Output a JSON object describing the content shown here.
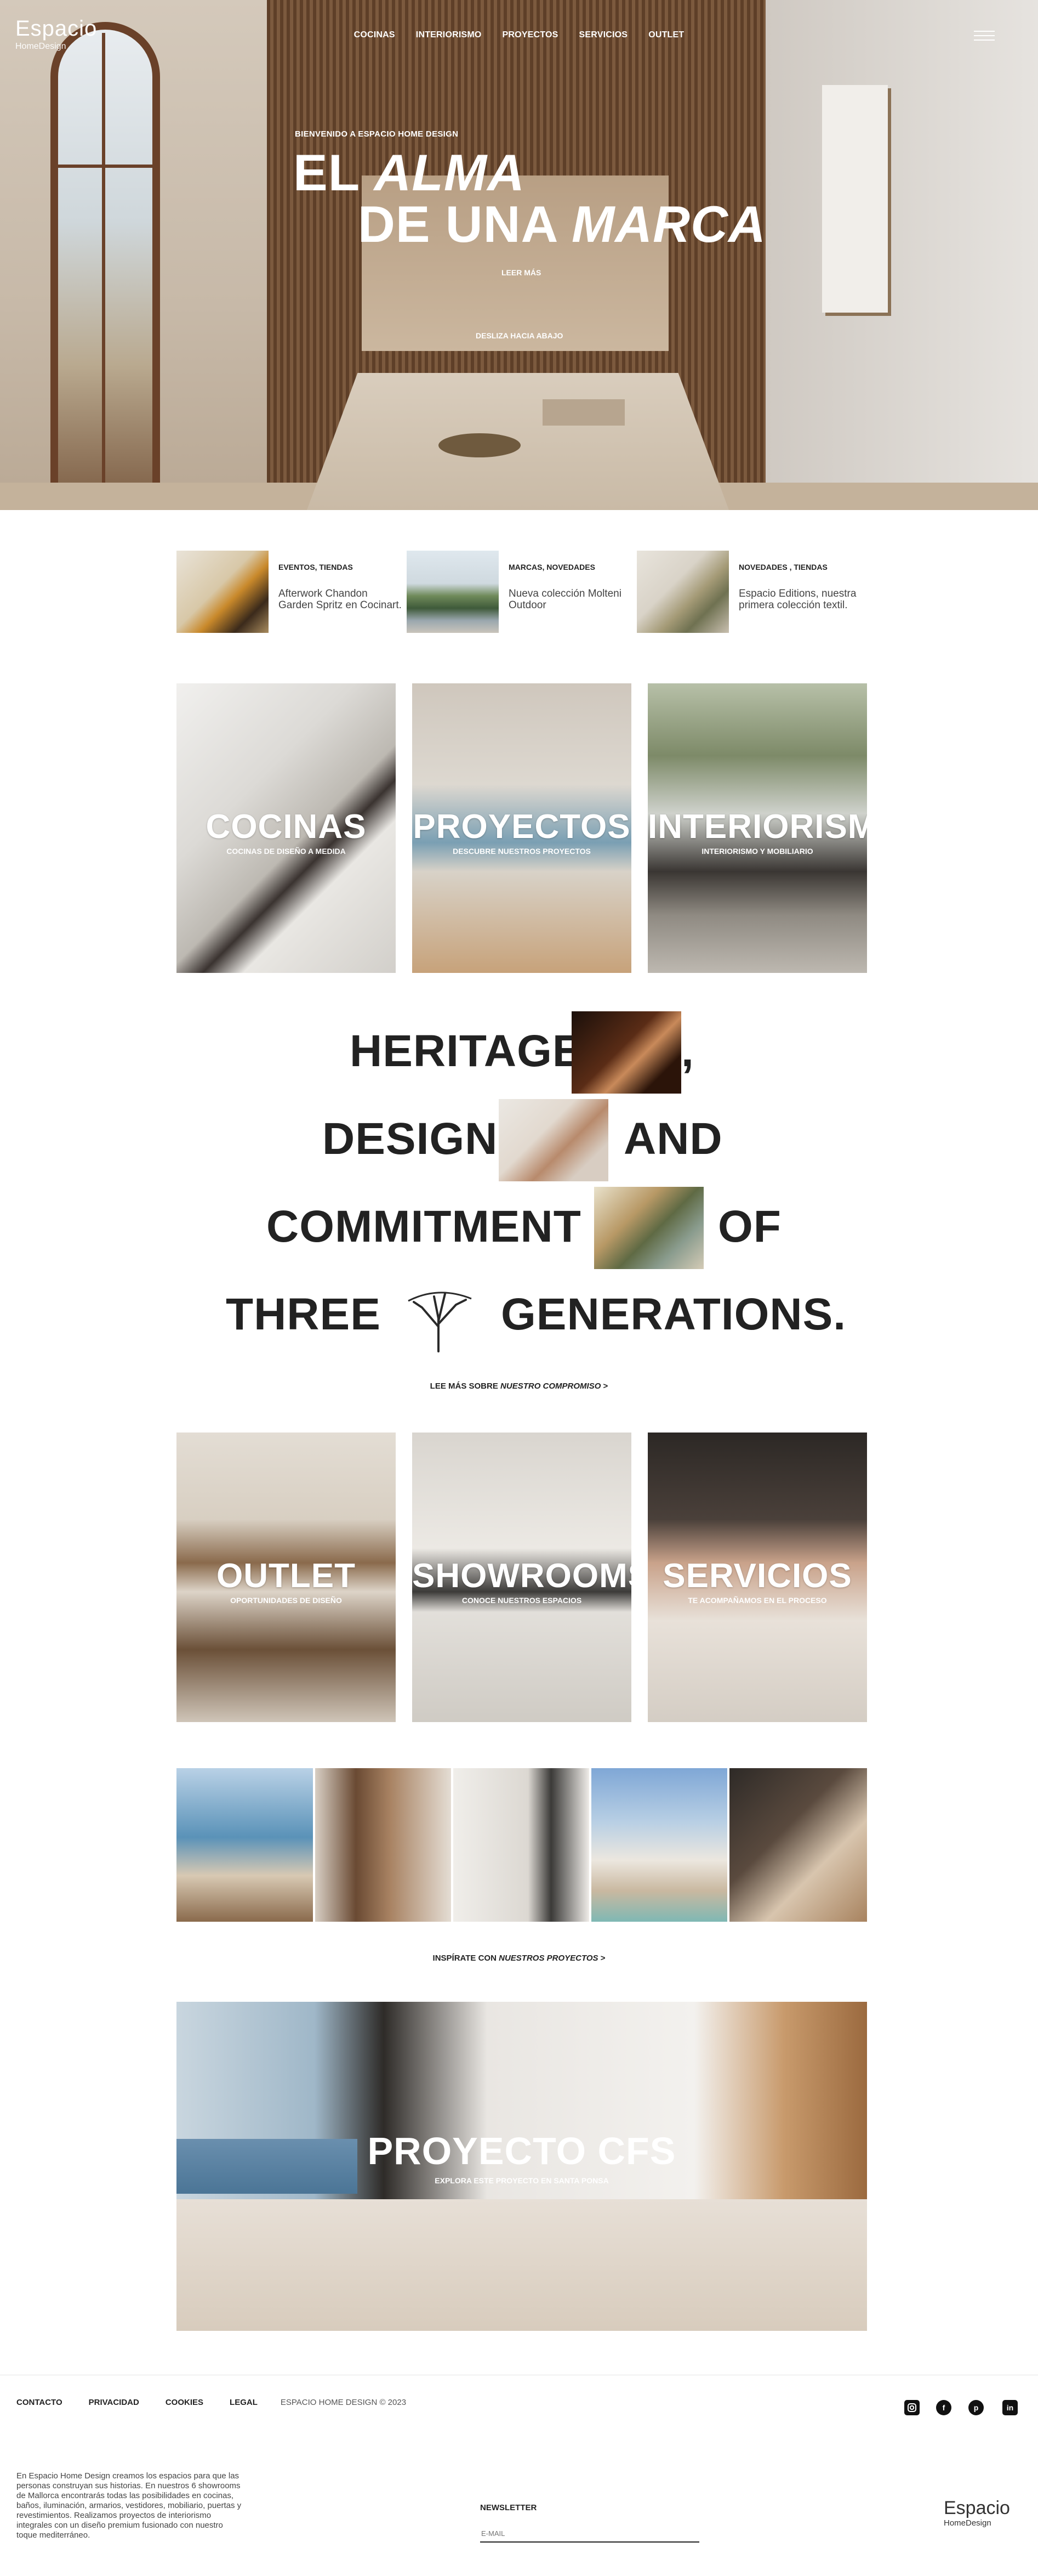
{
  "brand": {
    "logo_word": "Espacio",
    "logo_sub": "HomeDesign"
  },
  "nav": {
    "items": [
      "COCINAS",
      "INTERIORISMO",
      "PROYECTOS",
      "SERVICIOS",
      "OUTLET"
    ]
  },
  "hero": {
    "kicker": "BIENVENIDO A ESPACIO HOME DESIGN",
    "title_line1_a": "EL",
    "title_line1_b": "ALMA",
    "title_line2_a": "DE UNA",
    "title_line2_b": "MARCA",
    "read_more": "LEER MÁS",
    "scroll_hint": "DESLIZA HACIA ABAJO"
  },
  "news": [
    {
      "category": "EVENTOS, TIENDAS",
      "text": "Afterwork Chandon Garden Spritz en Cocinart."
    },
    {
      "category": "MARCAS, NOVEDADES",
      "text": "Nueva colección Molteni Outdoor"
    },
    {
      "category": "NOVEDADES , TIENDAS",
      "text": "Espacio Editions, nuestra primera colección textil."
    }
  ],
  "cards_top": [
    {
      "title": "COCINAS",
      "subtitle": "COCINAS DE DISEÑO A MEDIDA"
    },
    {
      "title": "PROYECTOS",
      "subtitle": "DESCUBRE NUESTROS PROYECTOS"
    },
    {
      "title": "INTERIORISMO",
      "subtitle": "INTERIORISMO Y MOBILIARIO"
    }
  ],
  "heritage": {
    "w1": "HERITAGE",
    "comma": ",",
    "w2": "DESIGN",
    "w3": "AND",
    "w4": "COMMITMENT",
    "w5": "OF",
    "w6": "THREE",
    "w7": "GENERATIONS.",
    "link_prefix": "LEE MÁS SOBRE ",
    "link_em": "NUESTRO COMPROMISO",
    "link_suffix": " >"
  },
  "cards_bottom": [
    {
      "title": "OUTLET",
      "subtitle": "OPORTUNIDADES DE DISEÑO"
    },
    {
      "title": "SHOWROOMS",
      "subtitle": "CONOCE NUESTROS ESPACIOS"
    },
    {
      "title": "SERVICIOS",
      "subtitle": "TE ACOMPAÑAMOS EN EL PROCESO"
    }
  ],
  "projects_link": {
    "prefix": "INSPÍRATE CON ",
    "em": "NUESTROS PROYECTOS",
    "suffix": " >"
  },
  "feature": {
    "title": "PROYECTO CFS",
    "subtitle": "EXPLORA ESTE PROYECTO EN SANTA PONSA"
  },
  "footer": {
    "links": [
      "CONTACTO",
      "PRIVACIDAD",
      "COOKIES",
      "LEGAL"
    ],
    "copyright": "ESPACIO HOME DESIGN © 2023",
    "social": [
      "instagram-icon",
      "facebook-icon",
      "pinterest-icon",
      "linkedin-icon"
    ],
    "about": "En Espacio Home Design creamos los espacios para que las personas construyan sus historias. En nuestros 6 showrooms de Mallorca encontrarás todas las posibilidades en cocinas, baños, iluminación, armarios, vestidores, mobiliario, puertas y revestimientos. Realizamos proyectos de interiorismo integrales con un diseño premium fusionado con nuestro toque mediterráneo.",
    "newsletter_label": "NEWSLETTER",
    "email_placeholder": "E-MAIL",
    "logo_word": "Espacio",
    "logo_sub": "HomeDesign"
  }
}
